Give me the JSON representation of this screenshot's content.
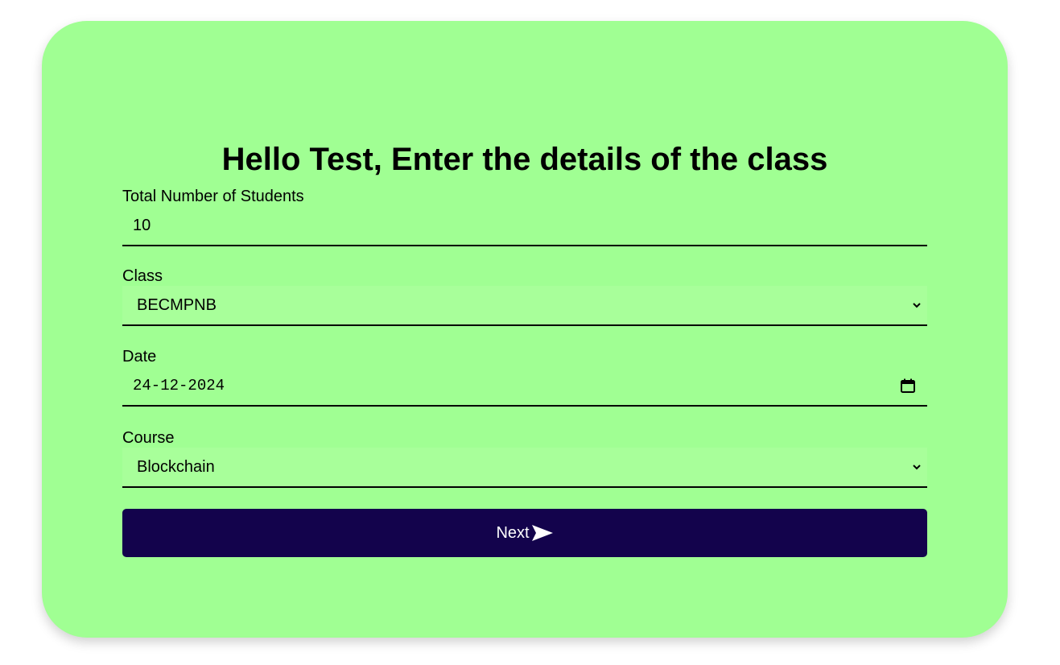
{
  "header": {
    "title": "Hello Test, Enter the details of the class"
  },
  "form": {
    "students": {
      "label": "Total Number of Students",
      "value": "10"
    },
    "class": {
      "label": "Class",
      "value": "BECMPNB"
    },
    "date": {
      "label": "Date",
      "value": "24-12-2024"
    },
    "course": {
      "label": "Course",
      "value": "Blockchain"
    }
  },
  "actions": {
    "next_label": "Next",
    "next_icon": "send-arrow-icon"
  },
  "colors": {
    "card_bg": "#a0ff93",
    "select_bg": "#a8ff9a",
    "button_bg": "#13034c",
    "button_text": "#ffffff"
  }
}
